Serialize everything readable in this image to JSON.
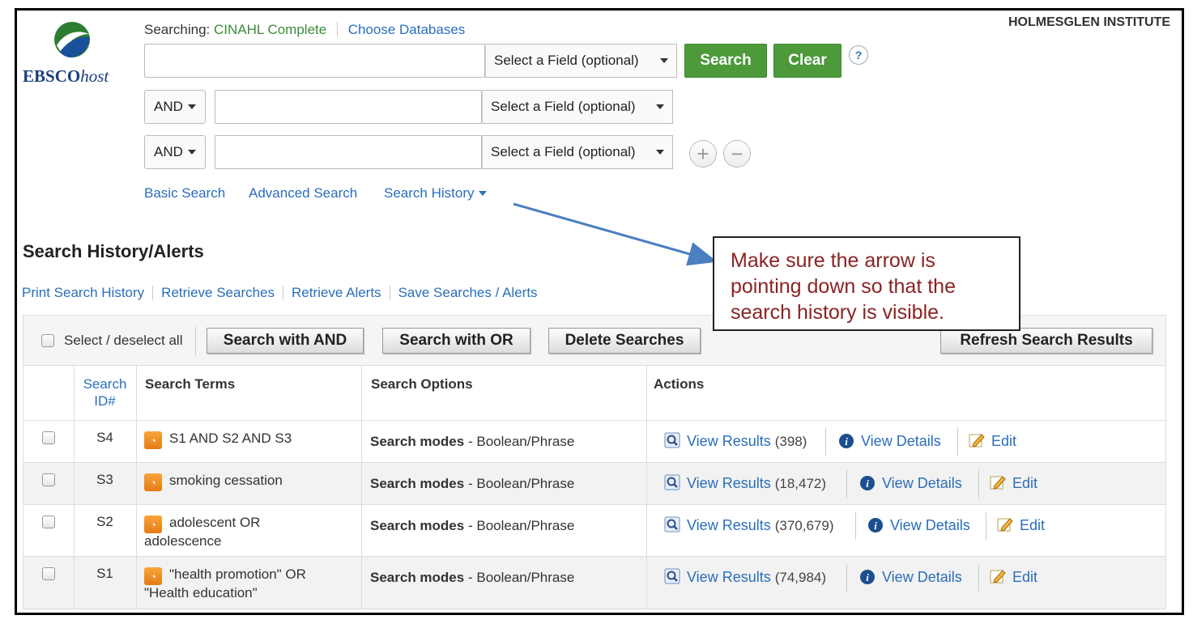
{
  "header": {
    "logo_text_bold": "EBSCO",
    "logo_text_italic": "host",
    "institution": "HOLMESGLEN INSTITUTE",
    "searching_label": "Searching:",
    "database": "CINAHL Complete",
    "choose_databases": "Choose Databases"
  },
  "search_form": {
    "field_select_label": "Select a Field (optional)",
    "boolean_operator": "AND",
    "search_button": "Search",
    "clear_button": "Clear",
    "help_label": "?"
  },
  "nav": {
    "basic_search": "Basic Search",
    "advanced_search": "Advanced Search",
    "search_history": "Search History"
  },
  "history": {
    "title": "Search History/Alerts",
    "links": [
      "Print Search History",
      "Retrieve Searches",
      "Retrieve Alerts",
      "Save Searches / Alerts"
    ],
    "select_all_label": "Select / deselect all",
    "buttons": {
      "search_with_and": "Search with AND",
      "search_with_or": "Search with OR",
      "delete_searches": "Delete Searches",
      "refresh": "Refresh Search Results"
    },
    "columns": {
      "search_id_line1": "Search",
      "search_id_line2": "ID#",
      "search_terms": "Search Terms",
      "search_options": "Search Options",
      "actions": "Actions"
    },
    "action_labels": {
      "view_results": "View Results",
      "view_details": "View Details",
      "edit": "Edit"
    },
    "options_label": "Search modes",
    "options_value": "- Boolean/Phrase",
    "rows": [
      {
        "id": "S4",
        "terms_line1": "S1 AND S2 AND S3",
        "terms_line2": "",
        "count": "(398)"
      },
      {
        "id": "S3",
        "terms_line1": "smoking cessation",
        "terms_line2": "",
        "count": "(18,472)"
      },
      {
        "id": "S2",
        "terms_line1": "adolescent OR",
        "terms_line2": "adolescence",
        "count": "(370,679)"
      },
      {
        "id": "S1",
        "terms_line1": "\"health promotion\" OR",
        "terms_line2": "\"Health education\"",
        "count": "(74,984)"
      }
    ]
  },
  "callout": {
    "text": "Make sure the arrow is pointing down so that the search history is visible."
  },
  "colors": {
    "link": "#2a6ebb",
    "green_button": "#4c9a3a",
    "callout_text": "#8b2323",
    "arrow": "#4a7fc0"
  }
}
